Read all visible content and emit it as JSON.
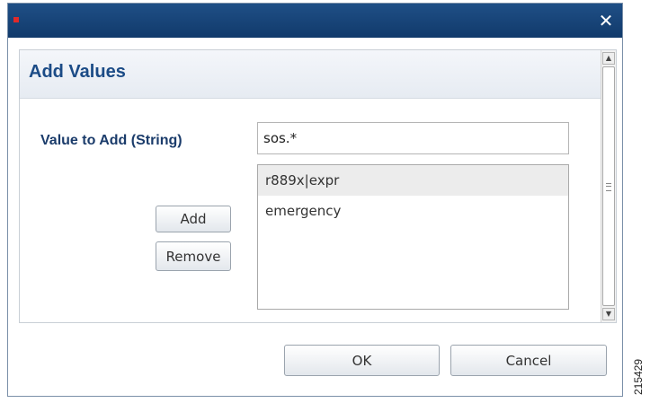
{
  "window": {
    "close_glyph": "✕",
    "accent_marker_color": "#e12a2a",
    "titlebar_color": "#1a4577"
  },
  "panel": {
    "title": "Add Values"
  },
  "form": {
    "field_label": "Value to Add (String)",
    "input_value": "sos.*",
    "values": [
      {
        "label": "r889x|expr",
        "selected": true
      },
      {
        "label": "emergency",
        "selected": false
      }
    ],
    "add_label": "Add",
    "remove_label": "Remove"
  },
  "footer": {
    "ok_label": "OK",
    "cancel_label": "Cancel"
  },
  "figure_number": "215429",
  "icons": {
    "close": "close-icon",
    "scroll_up": "scroll-up-icon",
    "scroll_down": "scroll-down-icon",
    "grip": "scroll-grip-icon"
  }
}
